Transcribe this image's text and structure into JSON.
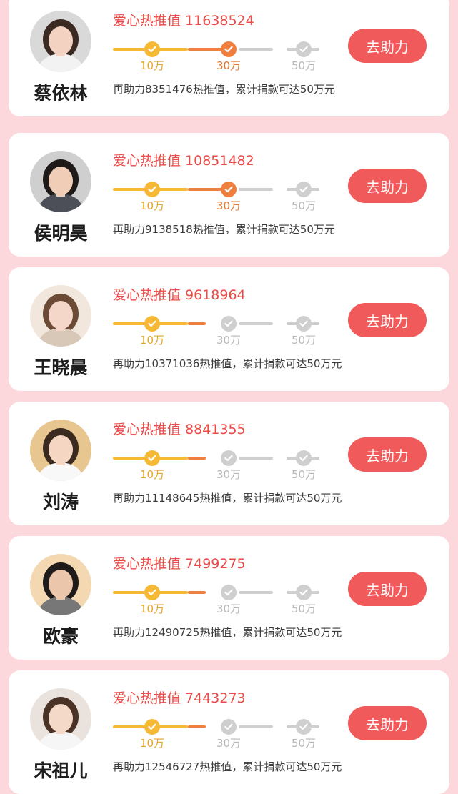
{
  "colors": {
    "background": "#fcd7dc",
    "accent_red": "#ec4a47",
    "button": "#f05a5a",
    "milestone_yellow": "#f5b936",
    "milestone_orange": "#f07f3d",
    "inactive_gray": "#cfcfcf"
  },
  "heat_label": "爱心热推值",
  "button_label": "去助力",
  "milestone_labels": [
    "10万",
    "30万",
    "50万"
  ],
  "cards": [
    {
      "name": "蔡依林",
      "heat_value": "11638524",
      "reached_milestones": 2,
      "description": "再助力8351476热推值，累计捐款可达50万元",
      "avatar_bg": "#d9d9d9",
      "avatar_skin": "#f3d2c1",
      "avatar_hair": "#3a2a22",
      "avatar_cloth": "#f2f2f2"
    },
    {
      "name": "侯明昊",
      "heat_value": "10851482",
      "reached_milestones": 2,
      "description": "再助力9138518热推值，累计捐款可达50万元",
      "avatar_bg": "#cfcfcf",
      "avatar_skin": "#efcdb7",
      "avatar_hair": "#1f1a18",
      "avatar_cloth": "#4d4f58"
    },
    {
      "name": "王晓晨",
      "heat_value": "9618964",
      "reached_milestones": 1,
      "description": "再助力10371036热推值，累计捐款可达50万元",
      "avatar_bg": "#f2e7dd",
      "avatar_skin": "#f4d7c8",
      "avatar_hair": "#6b4a36",
      "avatar_cloth": "#d8c8b8"
    },
    {
      "name": "刘涛",
      "heat_value": "8841355",
      "reached_milestones": 1,
      "description": "再助力11148645热推值，累计捐款可达50万元",
      "avatar_bg": "#e8c68f",
      "avatar_skin": "#f4d6c2",
      "avatar_hair": "#3b2a20",
      "avatar_cloth": "#f8f8f8"
    },
    {
      "name": "欧豪",
      "heat_value": "7499275",
      "reached_milestones": 1,
      "description": "再助力12490725热推值，累计捐款可达50万元",
      "avatar_bg": "#f3d8b2",
      "avatar_skin": "#ecc6aa",
      "avatar_hair": "#1e1b1a",
      "avatar_cloth": "#777777"
    },
    {
      "name": "宋祖儿",
      "heat_value": "7443273",
      "reached_milestones": 1,
      "description": "再助力12546727热推值，累计捐款可达50万元",
      "avatar_bg": "#eae3dd",
      "avatar_skin": "#f4d8c8",
      "avatar_hair": "#4a3326",
      "avatar_cloth": "#f6f6f6"
    }
  ]
}
